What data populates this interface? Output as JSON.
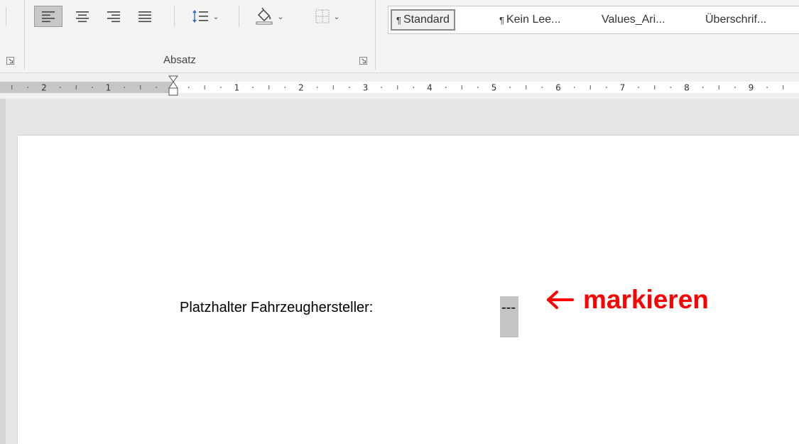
{
  "ribbon": {
    "paragraph_group": {
      "label": "Absatz",
      "buttons": [
        {
          "name": "align-left-button",
          "active": true
        },
        {
          "name": "align-center-button",
          "active": false
        },
        {
          "name": "align-right-button",
          "active": false
        },
        {
          "name": "justify-button",
          "active": false
        },
        {
          "name": "line-spacing-button",
          "active": false
        },
        {
          "name": "shading-button",
          "active": false
        },
        {
          "name": "borders-button",
          "active": false
        }
      ]
    },
    "styles_gallery": {
      "items": [
        {
          "pilcrow": "¶",
          "label": "Standard",
          "selected": true
        },
        {
          "pilcrow": "¶",
          "label": "Kein Lee...",
          "selected": false
        },
        {
          "pilcrow": "",
          "label": "Values_Ari...",
          "selected": false
        },
        {
          "pilcrow": "",
          "label": "Überschrif...",
          "selected": false
        }
      ]
    }
  },
  "ruler": {
    "left_numbers": [
      "2",
      "1"
    ],
    "right_numbers": [
      "1",
      "2",
      "3",
      "4",
      "5",
      "6",
      "7",
      "8",
      "9"
    ]
  },
  "document": {
    "placeholder_label": "Platzhalter Fahrzeughersteller:",
    "placeholder_value": "---"
  },
  "annotation": {
    "text": "markieren",
    "color": "#ff0000"
  }
}
